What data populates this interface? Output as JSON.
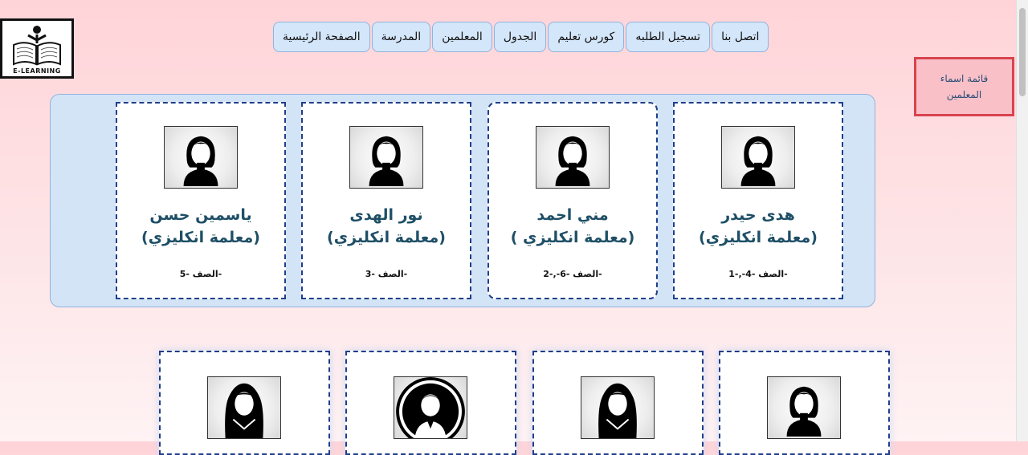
{
  "logo": {
    "text": "E-LEARNING",
    "icon": "book-person-icon"
  },
  "nav": {
    "items": [
      {
        "label": "اتصل بنا"
      },
      {
        "label": "تسجيل الطلبه"
      },
      {
        "label": "كورس تعليم"
      },
      {
        "label": "الجدول"
      },
      {
        "label": "المعلمين"
      },
      {
        "label": "المدرسة"
      },
      {
        "label": "الصفحة الرئيسية"
      }
    ]
  },
  "sidebar": {
    "label": "قائمة اسماء المعلمين"
  },
  "teachers": [
    {
      "name": "هدى حيدر",
      "role": "(معلمة انكليزي)",
      "grade": "الصف -4-,-1-",
      "avatar": "woman-avatar-icon"
    },
    {
      "name": "مني احمد",
      "role": "( معلمة انكليزي)",
      "grade": "الصف -6-,-2-",
      "avatar": "woman-avatar-icon"
    },
    {
      "name": "نور الهدى",
      "role": "(معلمة انكليزي)",
      "grade": "الصف -3-",
      "avatar": "woman-avatar-icon"
    },
    {
      "name": "ياسمين حسن",
      "role": "(معلمة انكليزي)",
      "grade": "الصف -5-",
      "avatar": "woman-avatar-icon"
    }
  ],
  "teachers_row2": [
    {
      "avatar": "woman-avatar-icon"
    },
    {
      "avatar": "hijab-woman-avatar-icon"
    },
    {
      "avatar": "man-avatar-icon"
    },
    {
      "avatar": "hijab-woman-avatar-icon"
    }
  ],
  "colors": {
    "nav_bg": "#d4e6fa",
    "panel_bg": "#d4e4f7",
    "card_border": "#1f3f8a",
    "name_text": "#1e4f66",
    "sidebar_border": "#d9434e"
  }
}
